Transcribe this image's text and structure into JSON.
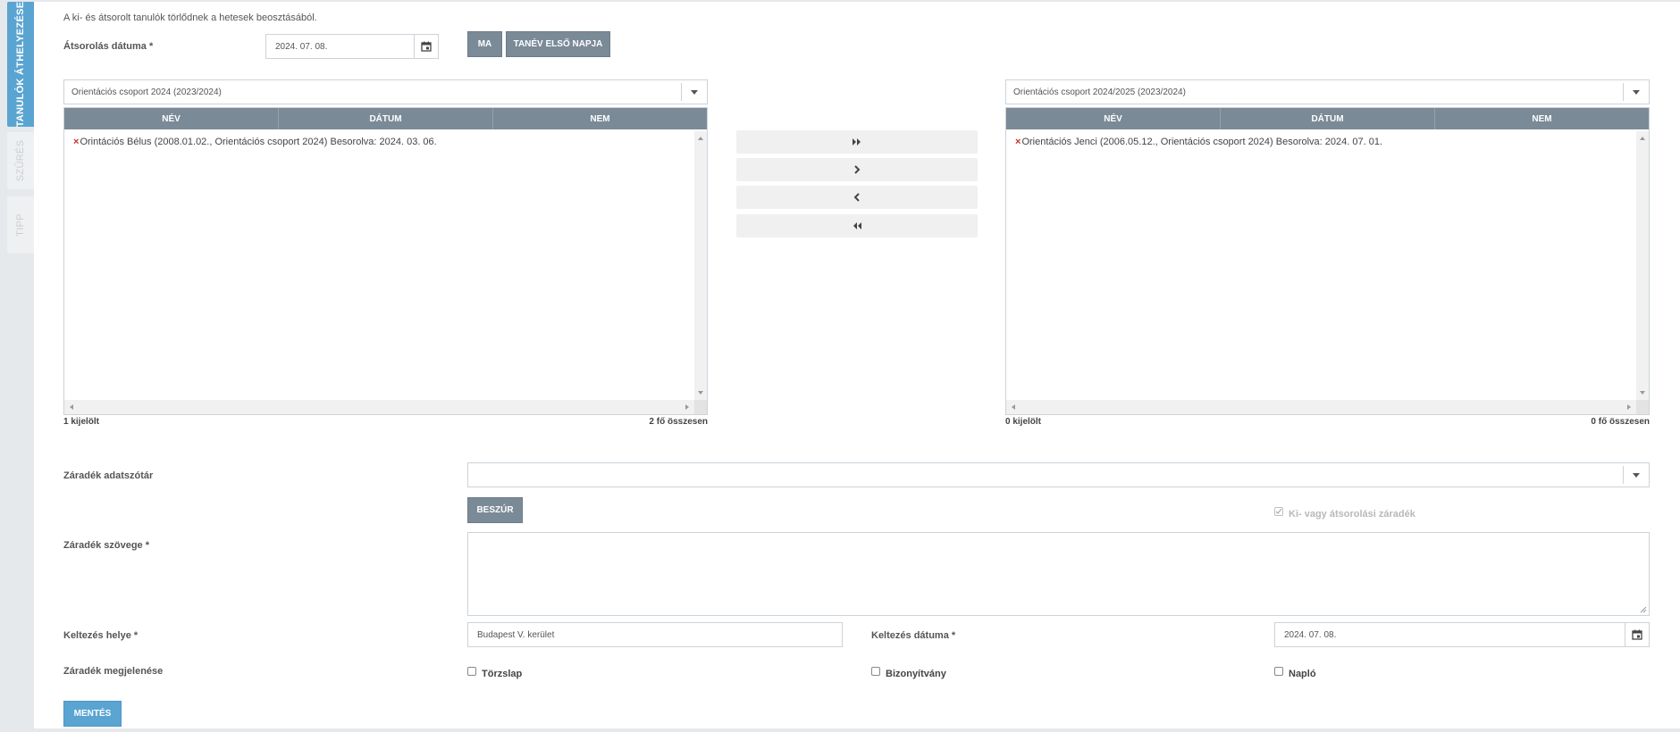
{
  "tabs": [
    {
      "label": "TANULÓK ÁTHELYEZÉSE",
      "active": true
    },
    {
      "label": "SZŰRÉS",
      "active": false
    },
    {
      "label": "TIPP",
      "active": false
    }
  ],
  "info_text": "A ki- és átsorolt tanulók törlődnek a hetesek beosztásából.",
  "date_field": {
    "label": "Átsorolás dátuma *",
    "value": "2024. 07. 08."
  },
  "quick_buttons": {
    "today": "MA",
    "first_day": "TANÉV ELSŐ NAPJA"
  },
  "left_group": {
    "select_value": "Orientációs csoport 2024 (2023/2024)",
    "columns": [
      "NÉV",
      "DÁTUM",
      "NEM"
    ],
    "rows": [
      "Orintációs Bélus (2008.01.02., Orientációs csoport 2024) Besorolva: 2024. 03. 06."
    ],
    "selected": "1 kijelölt",
    "total": "2 fő összesen"
  },
  "right_group": {
    "select_value": "Orientációs csoport 2024/2025 (2023/2024)",
    "columns": [
      "NÉV",
      "DÁTUM",
      "NEM"
    ],
    "rows": [
      "Orientációs Jenci (2006.05.12., Orientációs csoport 2024) Besorolva: 2024. 07. 01."
    ],
    "selected": "0 kijelölt",
    "total": "0 fő összesen"
  },
  "move_buttons": [
    "move-all-right",
    "move-right",
    "move-left",
    "move-all-left"
  ],
  "clause_dict": {
    "label": "Záradék adatszótár",
    "value": ""
  },
  "insert_button": "BESZÚR",
  "clause_checkbox": {
    "label": "Ki- vagy átsorolási záradék",
    "checked": true
  },
  "clause_text": {
    "label": "Záradék szövege *",
    "value": ""
  },
  "issue_place": {
    "label": "Keltezés helye *",
    "value": "Budapest V. kerület"
  },
  "issue_date": {
    "label": "Keltezés dátuma *",
    "value": "2024. 07. 08."
  },
  "appearance": {
    "label": "Záradék megjelenése",
    "options": [
      {
        "label": "Törzslap",
        "checked": false
      },
      {
        "label": "Bizonyítvány",
        "checked": false
      },
      {
        "label": "Napló",
        "checked": false
      }
    ]
  },
  "save_button": "MENTÉS",
  "colors": {
    "accent": "#5aa4d2",
    "header_gray": "#7b8a97",
    "error_red": "#c9302c"
  }
}
